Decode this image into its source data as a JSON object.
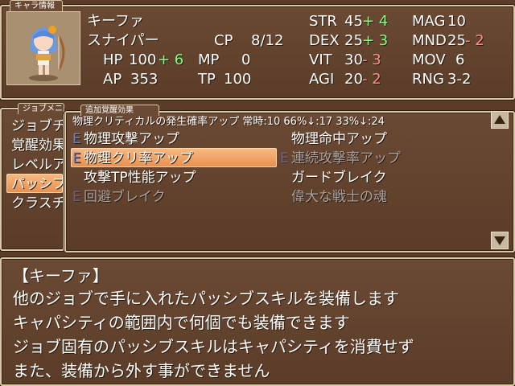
{
  "status_tab": "キャラ情報",
  "job_tab": "ジョブメニ",
  "passive_tab": "追加覚醒効果",
  "character": {
    "name": "キーファ",
    "job": "スナイパー",
    "cp_label": "CP",
    "cp_value": "8/12",
    "hp_label": "HP",
    "hp_value": "100",
    "hp_bonus": "+ 6",
    "mp_label": "MP",
    "mp_value": "0",
    "ap_label": "AP",
    "ap_value": "353",
    "tp_label": "TP",
    "tp_value": "100"
  },
  "stats": [
    {
      "label": "STR",
      "value": "45",
      "mod": "+ 4",
      "mod_type": "up"
    },
    {
      "label": "MAG",
      "value": "10",
      "mod": "",
      "mod_type": ""
    },
    {
      "label": "DEX",
      "value": "25",
      "mod": "+ 3",
      "mod_type": "up"
    },
    {
      "label": "MND",
      "value": "25",
      "mod": "- 2",
      "mod_type": "down"
    },
    {
      "label": "VIT",
      "value": "30",
      "mod": "- 3",
      "mod_type": "down"
    },
    {
      "label": "MOV",
      "value": "6",
      "mod": "",
      "mod_type": ""
    },
    {
      "label": "AGI",
      "value": "20",
      "mod": "- 2",
      "mod_type": "down"
    },
    {
      "label": "RNG",
      "value": "3-2",
      "mod": "",
      "mod_type": ""
    }
  ],
  "job_menu": [
    "ジョブチ",
    "覚醒効果",
    "レベルア",
    "パッシブ",
    "クラスチ"
  ],
  "job_menu_selected": 3,
  "skill_header": "物理クリティカルの発生確率アップ 常時:10 66%↓:17 33%↓:24",
  "skills": [
    {
      "equip": "E",
      "name": "物理攻撃アップ",
      "enabled": true
    },
    {
      "equip": "",
      "name": "物理命中アップ",
      "enabled": true
    },
    {
      "equip": "E",
      "name": "物理クリ率アップ",
      "enabled": true
    },
    {
      "equip": "E",
      "name": "連続攻撃率アップ",
      "enabled": false
    },
    {
      "equip": "",
      "name": "攻撃TP性能アップ",
      "enabled": true
    },
    {
      "equip": "",
      "name": "ガードブレイク",
      "enabled": true
    },
    {
      "equip": "E",
      "name": "回避ブレイク",
      "enabled": false
    },
    {
      "equip": "",
      "name": "偉大な戦士の魂",
      "enabled": false
    }
  ],
  "skills_selected": 2,
  "help": {
    "title": "【キーファ】",
    "lines": [
      "他のジョブで手に入れたパッシブスキルを装備します",
      "キャパシティの範囲内で何個でも装備できます",
      "ジョブ固有のパッシブスキルはキャパシティを消費せず",
      "また、装備から外す事ができません"
    ]
  }
}
